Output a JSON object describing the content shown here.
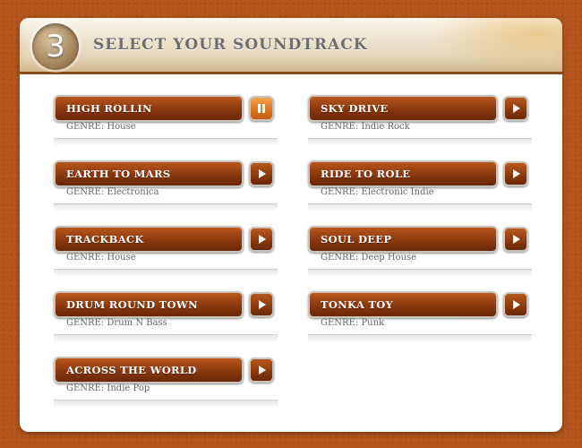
{
  "header": {
    "step_number": "3",
    "title": "SELECT YOUR SOUNDTRACK"
  },
  "colors": {
    "background": "#b4541c",
    "button": "#8d3a0e",
    "active_button": "#e07720",
    "genre_text": "#666666"
  },
  "tracks_left": [
    {
      "name": "HIGH ROLLIN",
      "genre": "GENRE: House",
      "control_icon": "pause-icon",
      "playing": true
    },
    {
      "name": "EARTH TO MARS",
      "genre": "GENRE: Electronica",
      "control_icon": "play-icon",
      "playing": false
    },
    {
      "name": "TRACKBACK",
      "genre": "GENRE: House",
      "control_icon": "play-icon",
      "playing": false
    },
    {
      "name": "DRUM ROUND TOWN",
      "genre": "GENRE: Drum N Bass",
      "control_icon": "play-icon",
      "playing": false
    },
    {
      "name": "ACROSS THE WORLD",
      "genre": "GENRE: Indie Pop",
      "control_icon": "play-icon",
      "playing": false
    }
  ],
  "tracks_right": [
    {
      "name": "SKY DRIVE",
      "genre": "GENRE: Indie Rock",
      "control_icon": "play-icon",
      "playing": false
    },
    {
      "name": "RIDE TO ROLE",
      "genre": "GENRE: Electronic Indie",
      "control_icon": "play-icon",
      "playing": false
    },
    {
      "name": "SOUL DEEP",
      "genre": "GENRE: Deep House",
      "control_icon": "play-icon",
      "playing": false
    },
    {
      "name": "TONKA TOY",
      "genre": "GENRE: Punk",
      "control_icon": "play-icon",
      "playing": false
    }
  ]
}
